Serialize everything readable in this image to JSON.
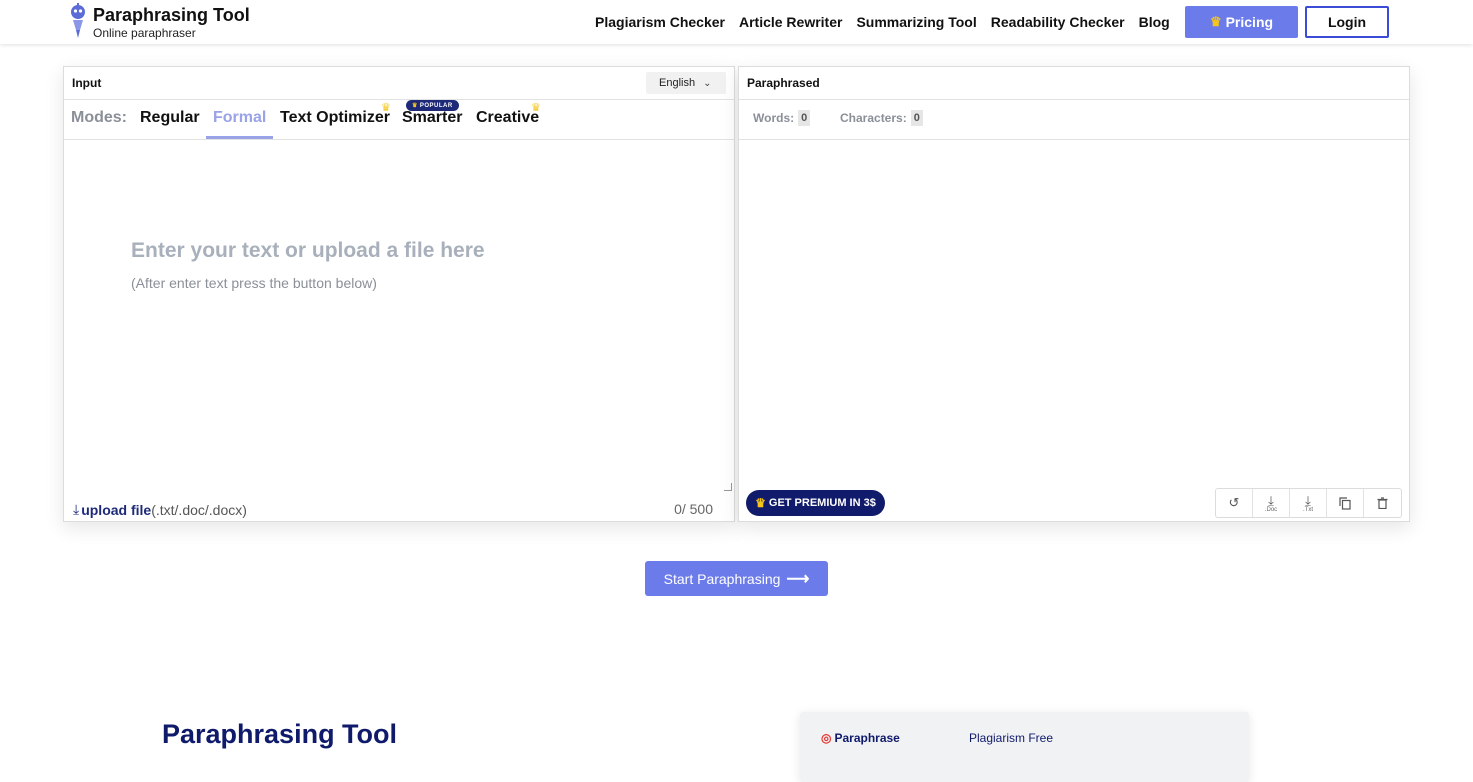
{
  "header": {
    "logo_title": "Paraphrasing Tool",
    "logo_subtitle": "Online paraphraser",
    "nav": [
      "Plagiarism Checker",
      "Article Rewriter",
      "Summarizing Tool",
      "Readability Checker",
      "Blog"
    ],
    "pricing_label": "Pricing",
    "login_label": "Login"
  },
  "input_panel": {
    "title": "Input",
    "language": "English",
    "modes_label": "Modes:",
    "modes": [
      "Regular",
      "Formal",
      "Text Optimizer",
      "Smarter",
      "Creative"
    ],
    "active_mode": "Formal",
    "popular_badge": "POPULAR",
    "placeholder_main": "Enter your text or upload a file here",
    "placeholder_sub": "(After enter text press the button below)",
    "upload_label": "upload file",
    "upload_types": "(.txt/.doc/.docx)",
    "counter": "0/ 500"
  },
  "output_panel": {
    "title": "Paraphrased",
    "words_label": "Words:",
    "words_value": "0",
    "chars_label": "Characters:",
    "chars_value": "0",
    "premium_label": "GET PREMIUM IN 3$",
    "doc_label": ".Doc",
    "txt_label": ".Txt"
  },
  "start_button": "Start Paraphrasing",
  "section": {
    "title": "Paraphrasing Tool",
    "card_tab1": "Paraphrase",
    "card_tab2": "Plagiarism Free"
  }
}
